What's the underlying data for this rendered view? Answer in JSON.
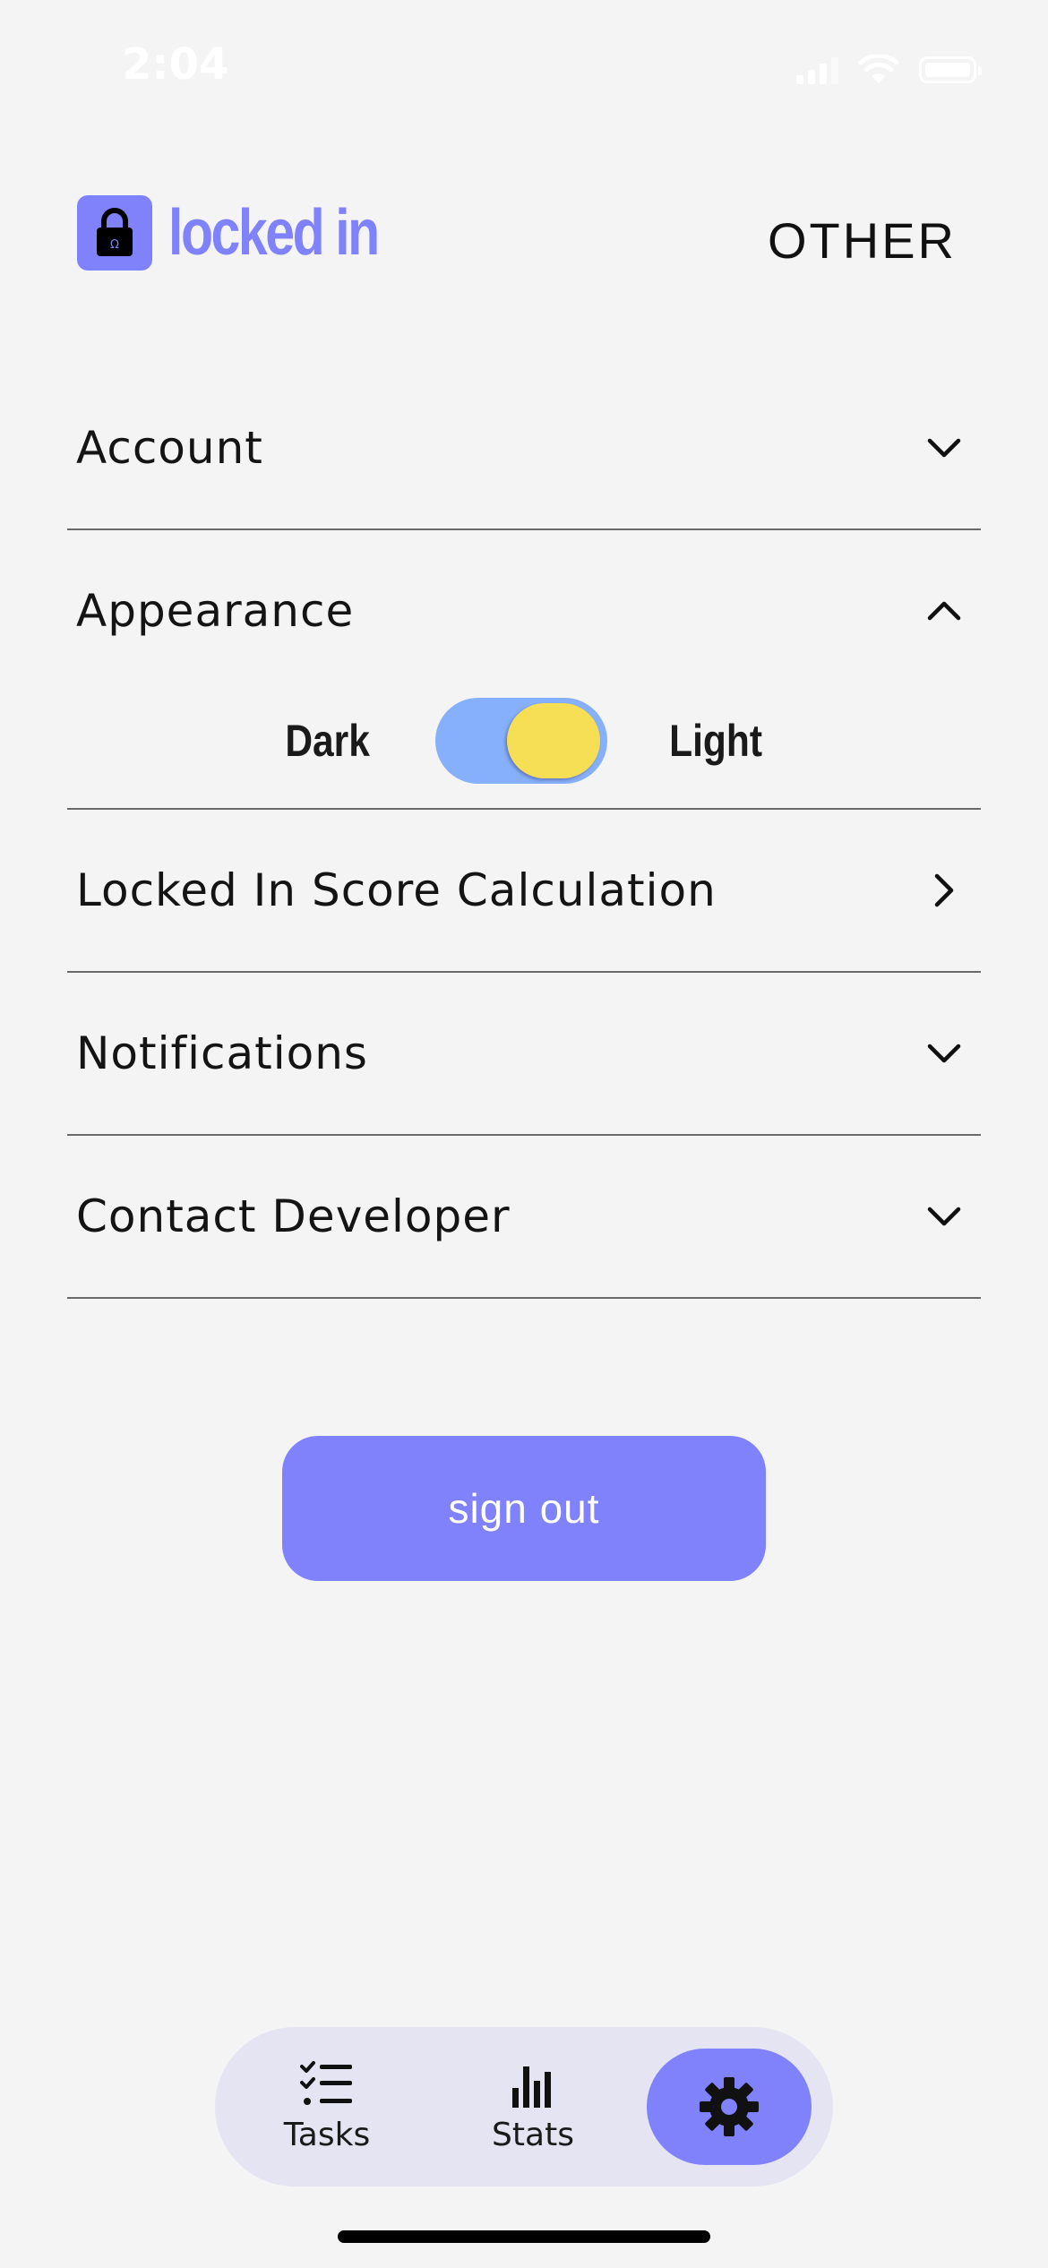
{
  "status_bar": {
    "time": "2:04",
    "icons": [
      "cellular-signal-icon",
      "wifi-icon",
      "battery-icon"
    ]
  },
  "header": {
    "logo_text": "locked in",
    "logo_icon": "padlock-icon",
    "page_title": "OTHER"
  },
  "settings": {
    "sections": [
      {
        "label": "Account",
        "state": "collapsed",
        "icon": "chevron-down-icon"
      },
      {
        "label": "Appearance",
        "state": "expanded",
        "icon": "chevron-up-icon"
      },
      {
        "label": "Locked In Score Calculation",
        "state": "link",
        "icon": "chevron-right-icon"
      },
      {
        "label": "Notifications",
        "state": "collapsed",
        "icon": "chevron-down-icon"
      },
      {
        "label": "Contact Developer",
        "state": "collapsed",
        "icon": "chevron-down-icon"
      }
    ],
    "appearance": {
      "dark_label": "Dark",
      "light_label": "Light",
      "selected": "Light"
    }
  },
  "sign_out_label": "sign out",
  "tab_bar": {
    "tabs": [
      {
        "label": "Tasks",
        "icon": "task-list-icon"
      },
      {
        "label": "Stats",
        "icon": "bar-chart-icon"
      },
      {
        "label": "",
        "icon": "gear-icon",
        "active": true
      }
    ]
  },
  "colors": {
    "accent": "#7f82fb",
    "background": "#f4f4f5",
    "toggle_track": "#86b0fb",
    "toggle_knob": "#f6df54",
    "tab_bar": "#e4e4f2"
  }
}
